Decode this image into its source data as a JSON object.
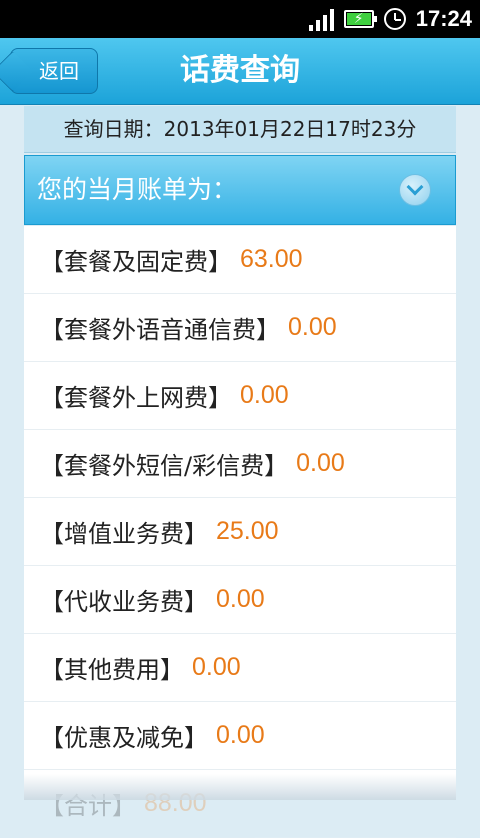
{
  "status_bar": {
    "time": "17:24",
    "icons": [
      "signal-icon",
      "battery-charging-icon",
      "alarm-icon"
    ]
  },
  "header": {
    "back_label": "返回",
    "title": "话费查询"
  },
  "query_date": "查询日期：2013年01月22日17时23分",
  "bill_header": {
    "label": "您的当月账单为：",
    "icon": "chevron-down-icon"
  },
  "bill_items": [
    {
      "label": "【套餐及固定费】",
      "amount": "63.00"
    },
    {
      "label": "【套餐外语音通信费】",
      "amount": "0.00"
    },
    {
      "label": "【套餐外上网费】",
      "amount": "0.00"
    },
    {
      "label": "【套餐外短信/彩信费】",
      "amount": "0.00"
    },
    {
      "label": "【增值业务费】",
      "amount": "25.00"
    },
    {
      "label": "【代收业务费】",
      "amount": "0.00"
    },
    {
      "label": "【其他费用】",
      "amount": "0.00"
    },
    {
      "label": "【优惠及减免】",
      "amount": "0.00"
    },
    {
      "label": "【合计】",
      "amount": "88.00"
    }
  ],
  "colors": {
    "accent": "#1ca3d9",
    "amount": "#e87a18",
    "background": "#dcecf4"
  }
}
